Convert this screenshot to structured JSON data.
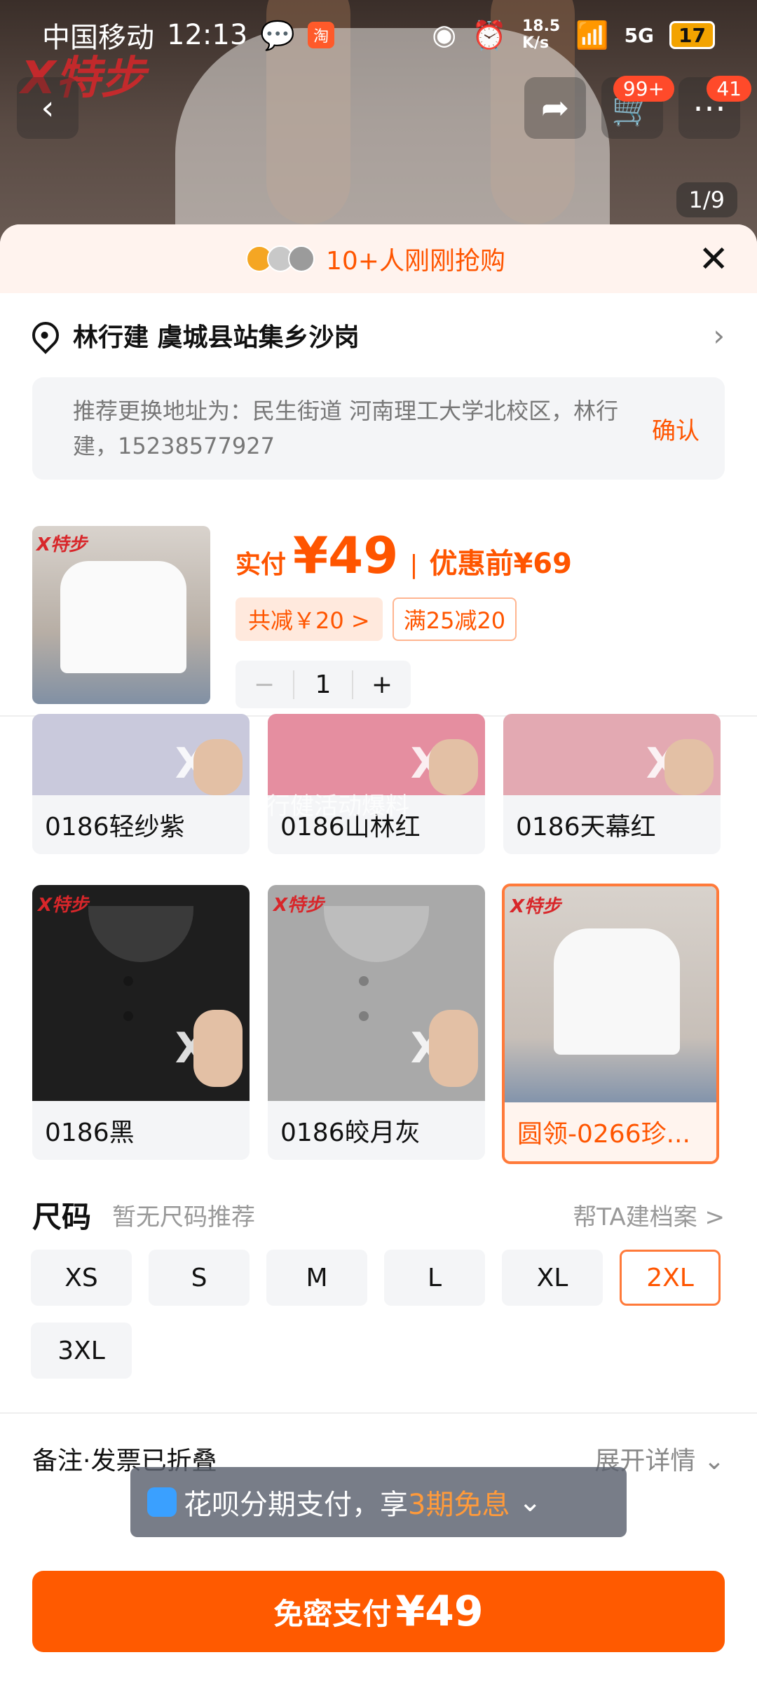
{
  "status_bar": {
    "carrier": "中国移动",
    "time": "12:13",
    "speed_top": "18.5",
    "speed_unit": "K/s",
    "network": "5G",
    "battery": "17"
  },
  "header": {
    "cart_badge": "99+",
    "message_badge": "41",
    "pager": "1/9"
  },
  "banner": {
    "text": "10+人刚刚抢购"
  },
  "address": {
    "text": "林行建 虞城县站集乡沙岗",
    "suggestion": "推荐更换地址为：民生街道 河南理工大学北校区，林行建，15238577927",
    "confirm_label": "确认"
  },
  "product": {
    "price_label": "实付",
    "price": "¥49",
    "original_label": "优惠前",
    "original_price": "¥69",
    "discount_tag": "共减￥20 >",
    "promo_tag": "满25减20",
    "quantity": "1",
    "minus": "−",
    "plus": "+"
  },
  "variants": [
    {
      "label": "0186轻纱紫",
      "color": "#c9c9dc"
    },
    {
      "label": "0186山林红",
      "color": "#e58ea0"
    },
    {
      "label": "0186天幕红",
      "color": "#e3a9b2"
    },
    {
      "label": "0186黑",
      "color": "#1e1e1e"
    },
    {
      "label": "0186皎月灰",
      "color": "#a9a9a9"
    },
    {
      "label": "圆领-0266珍...",
      "color": "#efefef"
    }
  ],
  "variant_overlay": "行健活动爆料",
  "size": {
    "title": "尺码",
    "subtitle": "暂无尺码推荐",
    "link": "帮TA建档案 >",
    "options": [
      "XS",
      "S",
      "M",
      "L",
      "XL",
      "2XL",
      "3XL"
    ],
    "selected": "2XL"
  },
  "remark": {
    "text": "备注·发票已折叠",
    "link": "展开详情 ⌄"
  },
  "toast": {
    "prefix": "花呗分期支付，享",
    "highlight": "3期免息",
    "suffix": "⌄"
  },
  "pay": {
    "label": "免密支付",
    "amount": "¥49"
  },
  "colors": {
    "accent": "#ff5500",
    "button": "#ff5a00"
  }
}
